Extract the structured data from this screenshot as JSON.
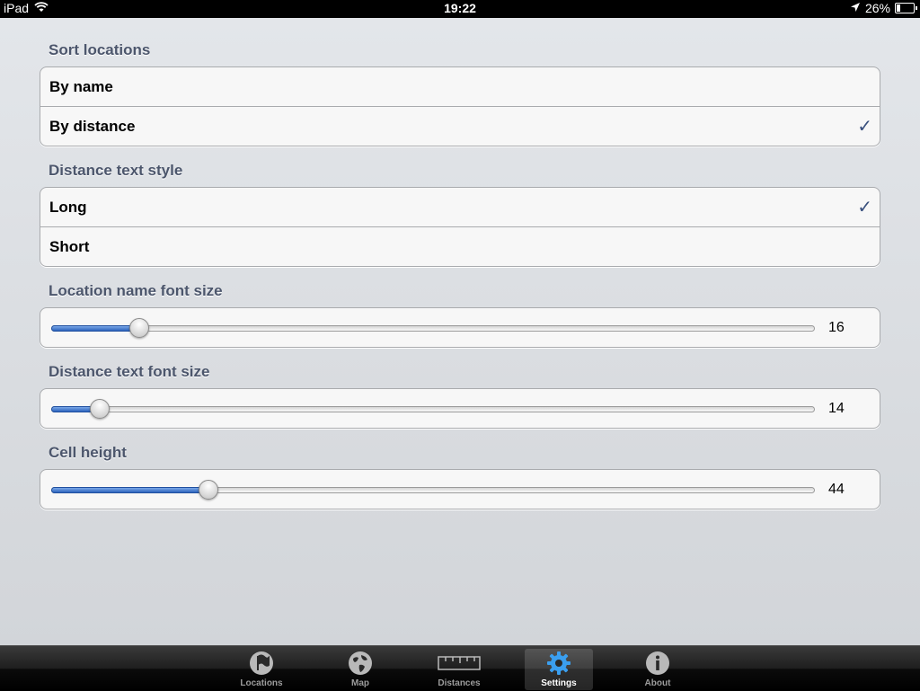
{
  "status_bar": {
    "device": "iPad",
    "time": "19:22",
    "battery": "26%",
    "battery_level": 0.26
  },
  "sections": {
    "sort": {
      "title": "Sort locations",
      "options": [
        {
          "label": "By name",
          "checked": false
        },
        {
          "label": "By distance",
          "checked": true
        }
      ]
    },
    "distance_style": {
      "title": "Distance text style",
      "options": [
        {
          "label": "Long",
          "checked": true
        },
        {
          "label": "Short",
          "checked": false
        }
      ]
    },
    "name_font": {
      "title": "Location name font size",
      "value": "16",
      "position": 0.115
    },
    "distance_font": {
      "title": "Distance text font size",
      "value": "14",
      "position": 0.063
    },
    "cell_height": {
      "title": "Cell height",
      "value": "44",
      "position": 0.206
    }
  },
  "check_mark": "✓",
  "tab_bar": {
    "tabs": [
      {
        "label": "Locations",
        "icon": "flag-icon",
        "selected": false
      },
      {
        "label": "Map",
        "icon": "globe-icon",
        "selected": false
      },
      {
        "label": "Distances",
        "icon": "ruler-icon",
        "selected": false
      },
      {
        "label": "Settings",
        "icon": "gear-icon",
        "selected": true
      },
      {
        "label": "About",
        "icon": "info-icon",
        "selected": false
      }
    ]
  },
  "colors": {
    "section_title": "#4c566c",
    "check": "#384f7d",
    "slider_fill": "#2c63bd",
    "selected_tab_icon": "#3a9ff0"
  }
}
